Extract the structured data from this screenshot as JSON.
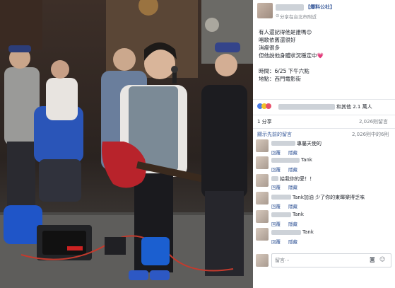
{
  "post": {
    "page_name": "【爆料公社】",
    "location": "分享在台北市附近",
    "lines": [
      "有人還記得他是誰嗎😊",
      "唱歌依舊還很好",
      "消瘦很多",
      "但他說他身體狀況穩定中💗"
    ],
    "time": "時間：6/25 下午六點",
    "place": "地點：西門電影街"
  },
  "reactions": {
    "text": "和其他 2.1 萬人"
  },
  "stats": {
    "shares": "1 分享",
    "comments": "2,026則留言"
  },
  "comments_header": {
    "show_previous": "顯示先前的留言",
    "count": "2,026則中的6則"
  },
  "comments": [
    {
      "name": "",
      "text": "專屬天使的",
      "actions": [
        "回覆",
        "隱藏"
      ]
    },
    {
      "name": "",
      "text": "Tank",
      "actions": [
        "回覆",
        "隱藏"
      ]
    },
    {
      "name": "",
      "text": "給我你的愛！！",
      "actions": [
        "回覆",
        "隱藏"
      ]
    },
    {
      "name": "",
      "text": "Tank加油 少了你的東暉樂得乏味",
      "actions": [
        "回覆",
        "隱藏"
      ]
    },
    {
      "name": "",
      "text": "Tank",
      "actions": [
        "回覆",
        "隱藏"
      ]
    },
    {
      "name": "",
      "text": "Tank",
      "actions": [
        "回覆",
        "隱藏"
      ]
    }
  ],
  "composer": {
    "placeholder": "留言⋯"
  },
  "colors": {
    "link": "#365899",
    "meta": "#7a7f86",
    "guitar": "#b8232b"
  }
}
